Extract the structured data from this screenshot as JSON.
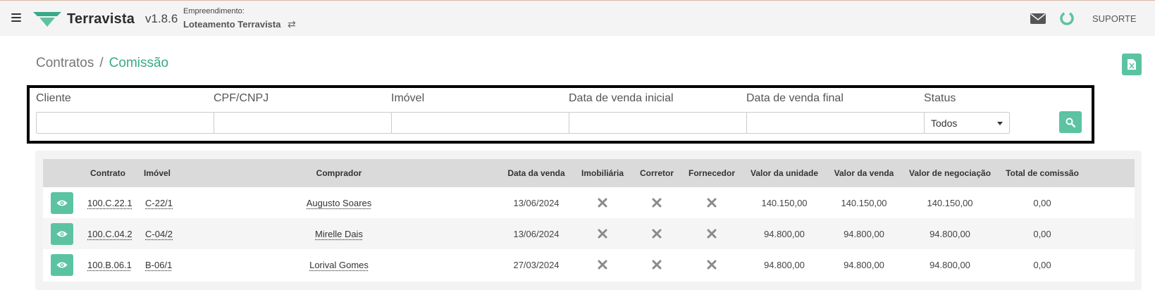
{
  "header": {
    "brand": "Terravista",
    "version": "v1.8.6",
    "empreendimento_label": "Empreendimento:",
    "empreendimento_name": "Loteamento Terravista",
    "swap_icon": "⇄",
    "support_label": "SUPORTE",
    "icons": [
      "menu-icon",
      "mail-icon",
      "loading-ring-icon"
    ],
    "colors": {
      "brand_green": "#3aa889",
      "accent": "#5cc3a2"
    }
  },
  "breadcrumb": {
    "parent": "Contratos",
    "separator": "/",
    "current": "Comissão"
  },
  "filters": {
    "cliente": {
      "label": "Cliente",
      "value": ""
    },
    "cpf": {
      "label": "CPF/CNPJ",
      "value": ""
    },
    "imovel": {
      "label": "Imóvel",
      "value": ""
    },
    "data_inicial": {
      "label": "Data de venda inicial",
      "value": ""
    },
    "data_final": {
      "label": "Data de venda final",
      "value": ""
    },
    "status": {
      "label": "Status",
      "value": "Todos"
    }
  },
  "table": {
    "headers": {
      "contrato": "Contrato",
      "imovel": "Imóvel",
      "comprador": "Comprador",
      "data_venda": "Data da venda",
      "imobiliaria": "Imobiliária",
      "corretor": "Corretor",
      "fornecedor": "Fornecedor",
      "valor_unidade": "Valor da unidade",
      "valor_venda": "Valor da venda",
      "valor_negociacao": "Valor de negociação",
      "total_comissao": "Total de comissão"
    },
    "rows": [
      {
        "contrato": "100.C.22.1",
        "imovel": "C-22/1",
        "comprador": "Augusto Soares",
        "data_venda": "13/06/2024",
        "imobiliaria": false,
        "corretor": false,
        "fornecedor": false,
        "valor_unidade": "140.150,00",
        "valor_venda": "140.150,00",
        "valor_negociacao": "140.150,00",
        "total_comissao": "0,00"
      },
      {
        "contrato": "100.C.04.2",
        "imovel": "C-04/2",
        "comprador": "Mirelle Dais",
        "data_venda": "13/06/2024",
        "imobiliaria": false,
        "corretor": false,
        "fornecedor": false,
        "valor_unidade": "94.800,00",
        "valor_venda": "94.800,00",
        "valor_negociacao": "94.800,00",
        "total_comissao": "0,00"
      },
      {
        "contrato": "100.B.06.1",
        "imovel": "B-06/1",
        "comprador": "Lorival Gomes",
        "data_venda": "27/03/2024",
        "imobiliaria": false,
        "corretor": false,
        "fornecedor": false,
        "valor_unidade": "94.800,00",
        "valor_venda": "94.800,00",
        "valor_negociacao": "94.800,00",
        "total_comissao": "0,00"
      }
    ]
  }
}
